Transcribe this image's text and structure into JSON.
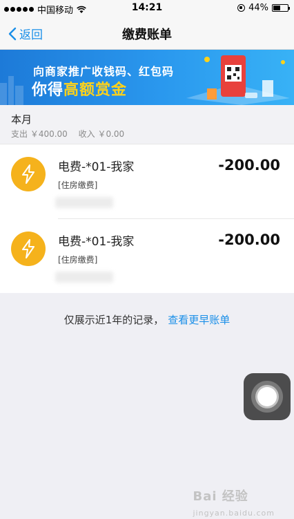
{
  "status": {
    "carrier": "中国移动",
    "time": "14:21",
    "battery": "44%",
    "battery_level": 0.44
  },
  "nav": {
    "back_label": "返回",
    "title": "缴费账单"
  },
  "banner": {
    "line1": "向商家推广收钱码、红包码",
    "line2_prefix": "你得",
    "line2_highlight": "高额赏金"
  },
  "summary": {
    "month": "本月",
    "expense": "支出 ￥400.00",
    "income": "收入 ￥0.00"
  },
  "bills": [
    {
      "name": "电费-*01-我家",
      "tag": "[住房缴费]",
      "amount": "-200.00",
      "icon": "lightning-icon"
    },
    {
      "name": "电费-*01-我家",
      "tag": "[住房缴费]",
      "amount": "-200.00",
      "icon": "lightning-icon"
    }
  ],
  "footer": {
    "note": "仅展示近1年的记录，",
    "link": "查看更早账单"
  },
  "watermark": {
    "text": "Bai 经验",
    "sub": "jingyan.baidu.com"
  },
  "colors": {
    "accent": "#1a8fe8",
    "bill_icon": "#f5b21c",
    "banner_highlight": "#ffd21a"
  }
}
